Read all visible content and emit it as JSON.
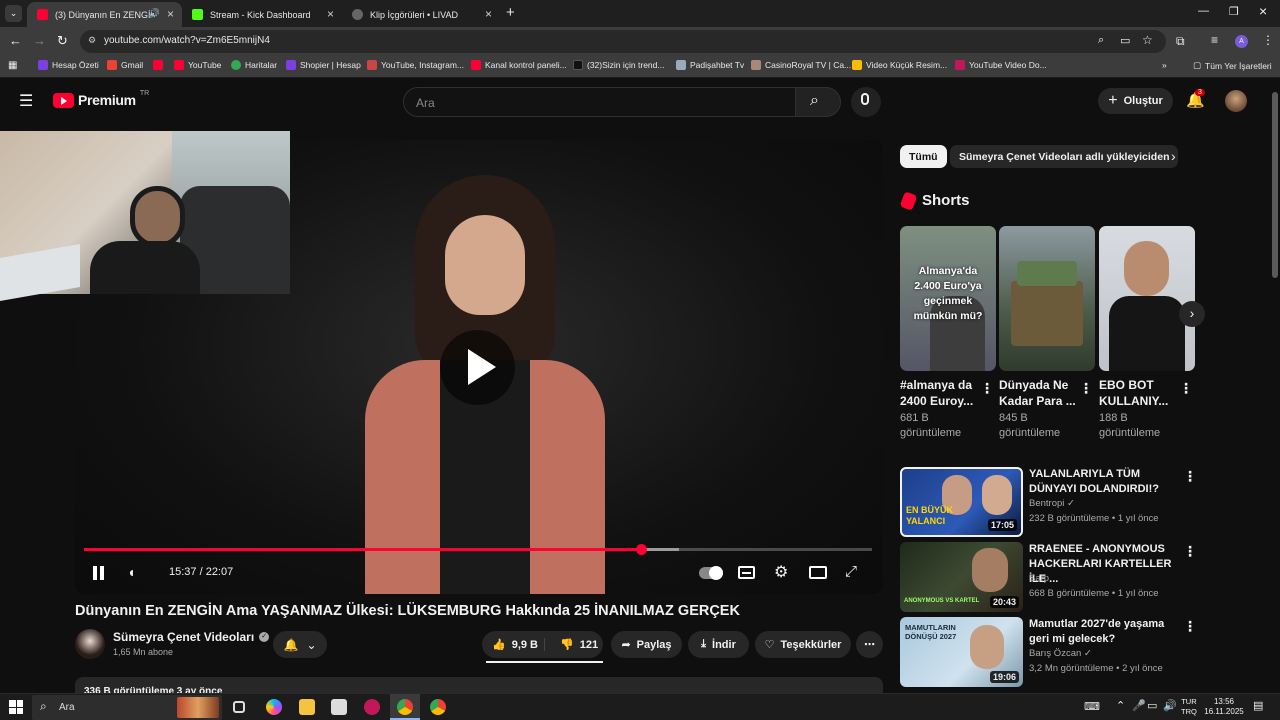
{
  "browser": {
    "tabs": [
      {
        "title": "(3) Dünyanın En ZENGİN Ama",
        "active": true
      },
      {
        "title": "Stream - Kick Dashboard",
        "active": false
      },
      {
        "title": "Klip İçgörüleri • LIVAD",
        "active": false
      }
    ],
    "url": "youtube.com/watch?v=Zm6E5mnijN4",
    "bookmarks": [
      "Hesap Özeti",
      "Gmail",
      "",
      "YouTube",
      "Haritalar",
      "Shopier | Hesap",
      "YouTube, Instagram...",
      "Kanal kontrol paneli...",
      "(32)Sizin için trend...",
      "Padişahbet Tv",
      "CasinoRoyal TV | Ca...",
      "Video Küçük Resim...",
      "YouTube Video Do..."
    ],
    "all_bookmarks": "Tüm Yer İşaretleri"
  },
  "header": {
    "logo": "Premium",
    "logo_region": "TR",
    "search_placeholder": "Ara",
    "create_label": "Oluştur",
    "notif_count": "3",
    "avatar_letter": "A"
  },
  "player": {
    "time": "15:37 / 22:07",
    "progress_fraction": 0.707,
    "buffer_fraction": 0.755
  },
  "video": {
    "title": "Dünyanın En ZENGİN Ama YAŞANMAZ Ülkesi: LÜKSEMBURG Hakkında 25 İNANILMAZ GERÇEK",
    "channel": "Sümeyra Çenet Videoları",
    "subscribers": "1,65 Mn abone",
    "likes": "9,9 B",
    "dislikes": "121",
    "share": "Paylaş",
    "download": "İndir",
    "thanks": "Teşekkürler",
    "desc_peek": "336 B görüntüleme  3 ay önce"
  },
  "chips": [
    "Tümü",
    "Sümeyra Çenet Videoları adlı yükleyiciden"
  ],
  "shorts": {
    "heading": "Shorts",
    "items": [
      {
        "title": "#almanya da 2400 Euroy...",
        "views": "681 B görüntüleme",
        "thumb_text": "Almanya'da 2.400 Euro'ya geçinmek mümkün mü?"
      },
      {
        "title": "Dünyada Ne Kadar Para ...",
        "views": "845 B görüntüleme"
      },
      {
        "title": "EBO BOT KULLANIY...",
        "views": "188 B görüntüleme"
      }
    ]
  },
  "recommended": [
    {
      "title": "YALANLARIYLA TÜM DÜNYAYI DOLANDIRDI!?",
      "channel": "Bentropi",
      "stats": "232 B görüntüleme • 1 yıl önce",
      "duration": "17:05",
      "thumb_text": "EN BÜYÜK YALANCI"
    },
    {
      "title": "RRAENEE - ANONYMOUS HACKERLARI KARTELLER İLE ...",
      "channel": "Sarp",
      "stats": "668 B görüntüleme • 1 yıl önce",
      "duration": "20:43",
      "thumb_text": "ANONYMOUS VS KARTEL"
    },
    {
      "title": "Mamutlar 2027'de yaşama geri mi gelecek?",
      "channel": "Barış Özcan",
      "stats": "3,2 Mn görüntüleme • 2 yıl önce",
      "duration": "19:06",
      "thumb_text": "MAMUTLARIN DÖNÜŞÜ 2027"
    }
  ],
  "taskbar": {
    "search": "Ara",
    "lang": "TUR",
    "lang2": "TRQ",
    "time": "13:56",
    "date": "16.11.2025"
  }
}
